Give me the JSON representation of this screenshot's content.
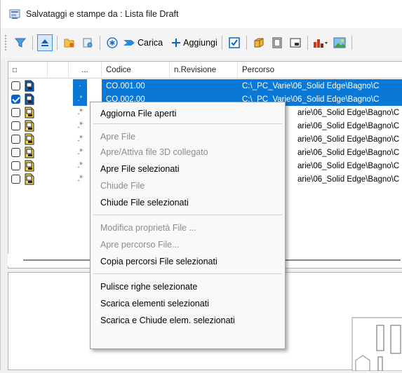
{
  "window": {
    "title": "Salvataggi e stampe da : Lista file Draft"
  },
  "toolbar": {
    "carica_label": "Carica",
    "aggiungi_label": "Aggiungi",
    "buttons": [
      "funnel-icon",
      "eject-icon",
      "open-folder-icon",
      "folder-settings-icon",
      "asterisk-icon",
      "carica-arrow-icon",
      "add-icon",
      "checkbox-icon",
      "box-3d-icon",
      "page-icon",
      "window-icon",
      "chart-icon",
      "image-icon"
    ]
  },
  "grid": {
    "columns": {
      "check": "□",
      "dots": "...",
      "codice": "Codice",
      "revisione": "n.Revisione",
      "percorso": "Percorso"
    },
    "rows": [
      {
        "checked": false,
        "selected": true,
        "dot": "·",
        "codice": "CO.001.00",
        "revisione": "",
        "percorso": "C:\\_PC_Varie\\06_Solid Edge\\Bagno\\C"
      },
      {
        "checked": true,
        "selected": true,
        "dot": ".°",
        "codice": "CO.002.00",
        "revisione": "",
        "percorso": "C:\\_PC_Varie\\06_Solid Edge\\Bagno\\C"
      },
      {
        "checked": false,
        "selected": false,
        "dot": ".°",
        "codice": "",
        "revisione": "",
        "percorso": "arie\\06_Solid Edge\\Bagno\\C"
      },
      {
        "checked": false,
        "selected": false,
        "dot": ".°",
        "codice": "",
        "revisione": "",
        "percorso": "arie\\06_Solid Edge\\Bagno\\C"
      },
      {
        "checked": false,
        "selected": false,
        "dot": ".°",
        "codice": "",
        "revisione": "",
        "percorso": "arie\\06_Solid Edge\\Bagno\\C"
      },
      {
        "checked": false,
        "selected": false,
        "dot": ".°",
        "codice": "",
        "revisione": "",
        "percorso": "arie\\06_Solid Edge\\Bagno\\C"
      },
      {
        "checked": false,
        "selected": false,
        "dot": ".°",
        "codice": "",
        "revisione": "",
        "percorso": "arie\\06_Solid Edge\\Bagno\\C"
      },
      {
        "checked": false,
        "selected": false,
        "dot": ".°",
        "codice": "",
        "revisione": "",
        "percorso": "arie\\06_Solid Edge\\Bagno\\C"
      }
    ]
  },
  "context_menu": {
    "items": [
      {
        "label": "Aggiorna File aperti",
        "enabled": true
      },
      {
        "label": "Apre File",
        "enabled": false
      },
      {
        "label": "Apre/Attiva file 3D collegato",
        "enabled": false
      },
      {
        "label": "Apre File selezionati",
        "enabled": true
      },
      {
        "label": "Chiude File",
        "enabled": false
      },
      {
        "label": "Chiude File selezionati",
        "enabled": true
      },
      {
        "label": "Modifica proprietà File ...",
        "enabled": false
      },
      {
        "label": "Apre percorso File...",
        "enabled": false
      },
      {
        "label": "Copia percorsi File selezionati",
        "enabled": true
      },
      {
        "label": "Pulisce righe selezionate",
        "enabled": true
      },
      {
        "label": "Scarica elementi selezionati",
        "enabled": true
      },
      {
        "label": "Scarica e Chiude elem. selezionati",
        "enabled": true
      }
    ]
  },
  "colors": {
    "selection": "#0a78d7",
    "accent": "#3a8ad6"
  }
}
